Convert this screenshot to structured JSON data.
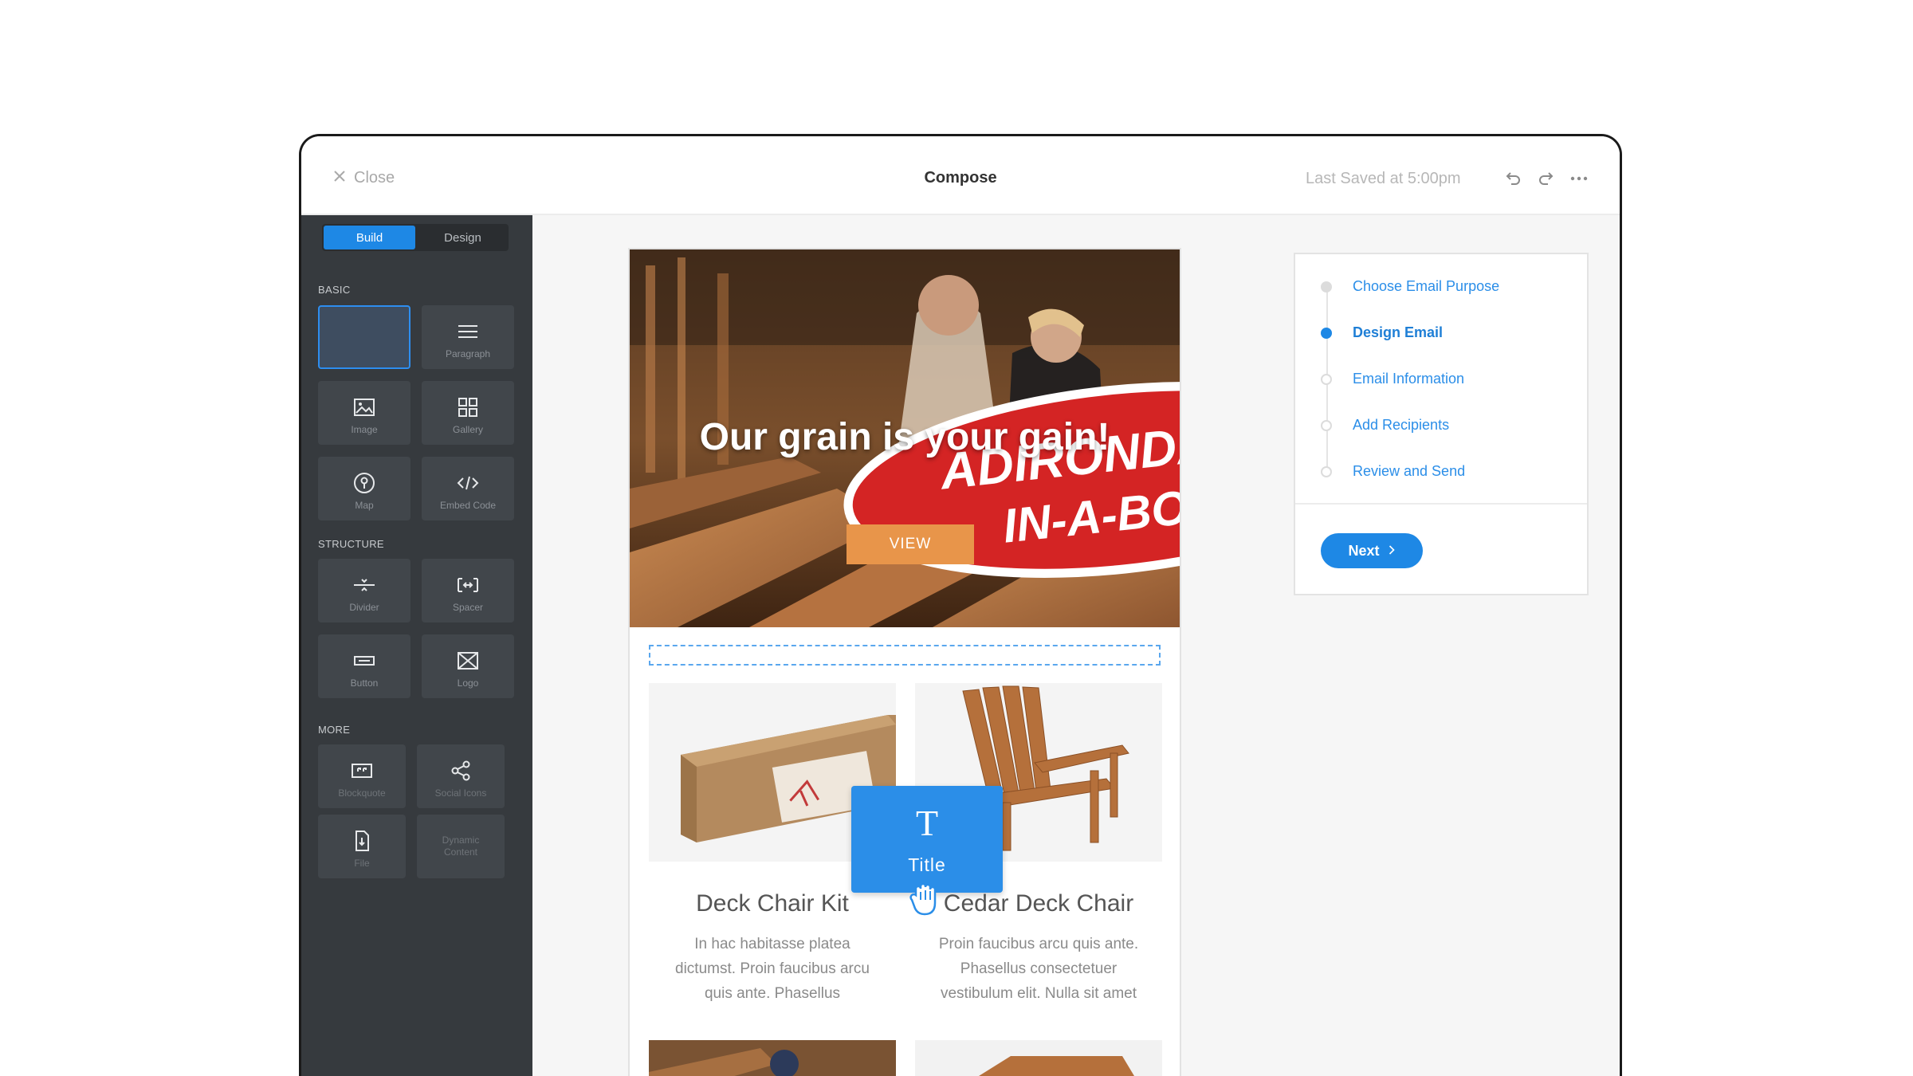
{
  "topbar": {
    "close_label": "Close",
    "title": "Compose",
    "last_saved": "Last Saved at 5:00pm"
  },
  "sidebar": {
    "tabs": [
      {
        "label": "Build",
        "active": true
      },
      {
        "label": "Design",
        "active": false
      }
    ],
    "sections": {
      "basic": "BASIC",
      "structure": "STRUCTURE",
      "more": "MORE"
    },
    "basic_items": [
      {
        "label": "",
        "icon": "empty-slot"
      },
      {
        "label": "Paragraph",
        "icon": "paragraph-icon"
      },
      {
        "label": "Image",
        "icon": "image-icon"
      },
      {
        "label": "Gallery",
        "icon": "gallery-icon"
      },
      {
        "label": "Map",
        "icon": "map-pin-icon"
      },
      {
        "label": "Embed Code",
        "icon": "code-icon"
      }
    ],
    "structure_items": [
      {
        "label": "Divider",
        "icon": "divider-icon"
      },
      {
        "label": "Spacer",
        "icon": "spacer-icon"
      },
      {
        "label": "Button",
        "icon": "button-icon"
      },
      {
        "label": "Logo",
        "icon": "logo-icon"
      }
    ],
    "more_items": [
      {
        "label": "Blockquote",
        "icon": "quote-icon"
      },
      {
        "label": "Social Icons",
        "icon": "share-icon"
      },
      {
        "label": "File",
        "icon": "file-icon"
      },
      {
        "label": "Dynamic Content",
        "icon": "none"
      }
    ]
  },
  "email": {
    "hero_badge_line1": "ADIRONDACK",
    "hero_badge_line2": "IN-A-BOX!",
    "hero_title": "Our grain is your gain!",
    "hero_button": "VIEW",
    "products": [
      {
        "name": "Deck Chair Kit",
        "description": "In hac habitasse platea dictumst. Proin faucibus arcu quis ante. Phasellus"
      },
      {
        "name": "Cedar Deck Chair",
        "description": "Proin faucibus arcu quis ante. Phasellus consectetuer vestibulum elit. Nulla sit amet"
      }
    ]
  },
  "drag_block": {
    "glyph": "T",
    "label": "Title"
  },
  "steps": {
    "items": [
      {
        "label": "Choose Email Purpose",
        "state": "done"
      },
      {
        "label": "Design Email",
        "state": "current"
      },
      {
        "label": "Email Information",
        "state": "pending"
      },
      {
        "label": "Add Recipients",
        "state": "pending"
      },
      {
        "label": "Review and Send",
        "state": "pending"
      }
    ],
    "next_label": "Next"
  },
  "colors": {
    "accent": "#1e88e5",
    "sidebar_bg": "#363a3e",
    "view_button": "#e8954a"
  }
}
